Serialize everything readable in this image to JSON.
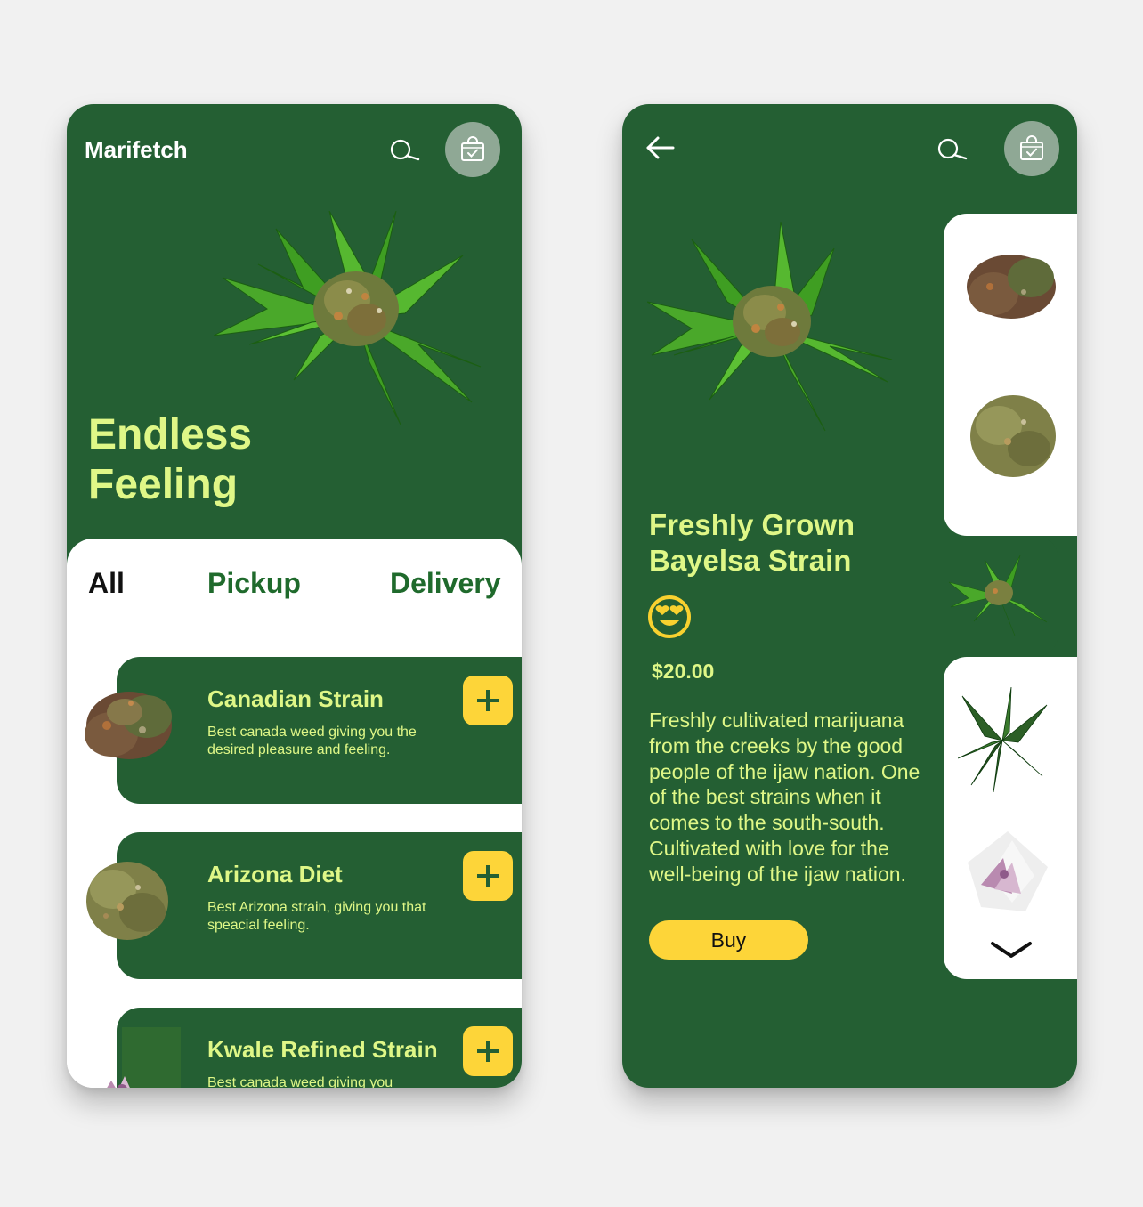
{
  "left_screen": {
    "brand": "Marifetch",
    "hero_title_line1": "Endless",
    "hero_title_line2": "Feeling",
    "tabs": [
      "All",
      "Pickup",
      "Delivery"
    ],
    "products": [
      {
        "name": "Canadian Strain",
        "description": "Best canada weed giving you the desired pleasure and feeling.",
        "add_label": "+"
      },
      {
        "name": "Arizona Diet",
        "description": "Best Arizona strain, giving you that speacial feeling.",
        "add_label": "+"
      },
      {
        "name": "Kwale Refined Strain",
        "description": "Best canada weed giving you",
        "add_label": "+"
      }
    ]
  },
  "right_screen": {
    "title_line1": "Freshly Grown",
    "title_line2": "Bayelsa Strain",
    "price": "$20.00",
    "description": "Freshly cultivated marijuana from the creeks by the good people of the ijaw nation. One of the best strains when it comes to the south-south. Cultivated with love for the well-being of the ijaw nation.",
    "buy_label": "Buy"
  },
  "colors": {
    "primary_green": "#245f33",
    "accent_lime": "#dff787",
    "accent_yellow": "#fdd539",
    "tab_green": "#1f6a2c",
    "cart_circle": "#8fa895"
  },
  "icons": [
    "search-icon",
    "shopping-bag-check-icon",
    "back-arrow-icon",
    "plus-icon",
    "heart-eyes-emoji-icon",
    "chevron-down-icon"
  ]
}
